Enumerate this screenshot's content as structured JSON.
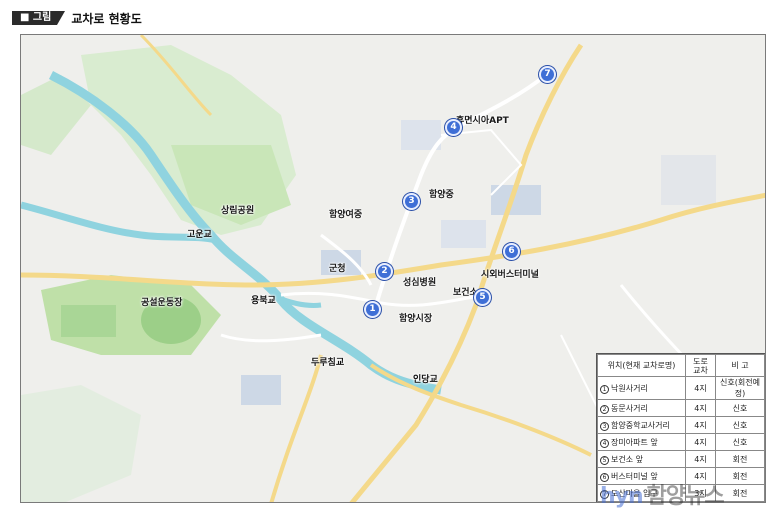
{
  "header": {
    "tag": "■ 그림",
    "title": "교차로 현황도"
  },
  "map": {
    "markers": [
      "1",
      "2",
      "3",
      "4",
      "5",
      "6",
      "7"
    ],
    "labels": {
      "apt": "휴면시아APT",
      "hamyang_middle": "함양중",
      "sangrim": "상림공원",
      "hamyang_girls": "함양여중",
      "goun_bridge": "고운교",
      "gunchung": "군청",
      "seongsim": "성심병원",
      "terminal": "시외버스터미널",
      "health": "보건소",
      "sports": "공설운동장",
      "yongpyeong_bridge": "용북교",
      "market": "함양시장",
      "duruchim_bridge": "두루침교",
      "indang_bridge": "인당교"
    }
  },
  "legend": {
    "headers": {
      "location": "위치(현재 교차로명)",
      "road": "도로\n교차",
      "note": "비 고"
    },
    "rows": [
      {
        "num": "1",
        "location": "낙원사거리",
        "road": "4지",
        "note": "신호(회전예정)"
      },
      {
        "num": "2",
        "location": "동문사거리",
        "road": "4지",
        "note": "신호"
      },
      {
        "num": "3",
        "location": "함양중학교사거리",
        "road": "4지",
        "note": "신호"
      },
      {
        "num": "4",
        "location": "장미아파트 앞",
        "road": "4지",
        "note": "신호"
      },
      {
        "num": "5",
        "location": "보건소 앞",
        "road": "4지",
        "note": "회전"
      },
      {
        "num": "6",
        "location": "버스터미널 앞",
        "road": "4지",
        "note": "회전"
      },
      {
        "num": "7",
        "location": "도산마을 입구",
        "road": "3지",
        "note": "회전"
      }
    ]
  },
  "watermark": {
    "part1": "hyn",
    "part2": "함양뉴스"
  },
  "colors": {
    "river": "#8fd3df",
    "park": "#bfe0a8",
    "road_major": "#f4d98a",
    "marker": "#3f6fd6",
    "block": "#cdd8e6"
  }
}
